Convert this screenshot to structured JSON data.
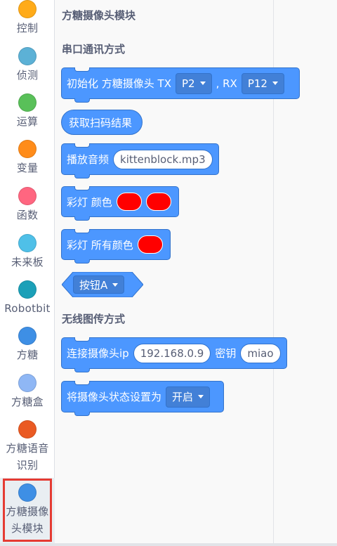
{
  "sidebar": {
    "categories": [
      {
        "label": "控制",
        "color": "#ffab19"
      },
      {
        "label": "侦测",
        "color": "#5cb1d6"
      },
      {
        "label": "运算",
        "color": "#59c059"
      },
      {
        "label": "变量",
        "color": "#ff8c1a"
      },
      {
        "label": "函数",
        "color": "#ff6680"
      },
      {
        "label": "未来板",
        "color": "#4fc0e8"
      },
      {
        "label": "Robotbit",
        "color": "#1ba0b8"
      },
      {
        "label": "方糖",
        "color": "#3e8fe5"
      },
      {
        "label": "方糖盒",
        "color": "#8fb7f5"
      },
      {
        "label": "方糖语音识别",
        "color": "#ea5a23"
      },
      {
        "label": "方糖摄像头模块",
        "color": "#3e8fe5",
        "active": true
      }
    ]
  },
  "flyout": {
    "section_title": "方糖摄像头模块",
    "serial": {
      "heading": "串口通讯方式",
      "init_block": {
        "text": "初始化 方糖摄像头 TX",
        "tx_value": "P2",
        "rx_label": ", RX",
        "rx_value": "P12"
      },
      "scan_block": {
        "text": "获取扫码结果"
      },
      "audio_block": {
        "text": "播放音频",
        "file": "kittenblock.mp3"
      },
      "led_color_block": {
        "text": "彩灯 颜色",
        "color1": "#ff0000",
        "color2": "#ff0000"
      },
      "led_all_block": {
        "text": "彩灯 所有颜色",
        "color": "#ff0000"
      },
      "button_block": {
        "value": "按钮A"
      }
    },
    "wireless": {
      "heading": "无线图传方式",
      "connect_block": {
        "text": "连接摄像头ip",
        "ip": "192.168.0.9",
        "key_label": "密钥",
        "key": "miao"
      },
      "state_block": {
        "text": "将摄像头状态设置为",
        "state": "开启"
      }
    },
    "block_color": "#4c97ff",
    "block_border": "#3373cc"
  }
}
